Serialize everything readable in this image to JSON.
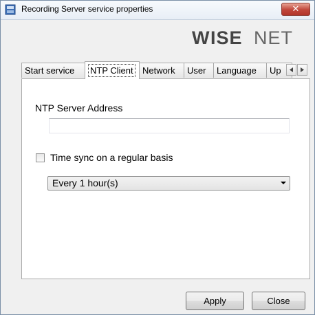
{
  "window": {
    "title": "Recording Server service properties"
  },
  "brand": {
    "logo_text": "WISENET"
  },
  "tabs": [
    {
      "label": "Start service"
    },
    {
      "label": "NTP Client",
      "active": true
    },
    {
      "label": "Network"
    },
    {
      "label": "User"
    },
    {
      "label": "Language"
    },
    {
      "label": "Up"
    }
  ],
  "ntp": {
    "server_address_label": "NTP Server Address",
    "server_address_value": "",
    "time_sync_label": "Time sync on a regular basis",
    "time_sync_checked": false,
    "interval_selected": "Every 1 hour(s)"
  },
  "buttons": {
    "apply": "Apply",
    "close": "Close"
  },
  "icons": {
    "close": "x-icon",
    "scroll_left": "triangle-left-icon",
    "scroll_right": "triangle-right-icon",
    "dropdown": "chevron-down-icon"
  }
}
